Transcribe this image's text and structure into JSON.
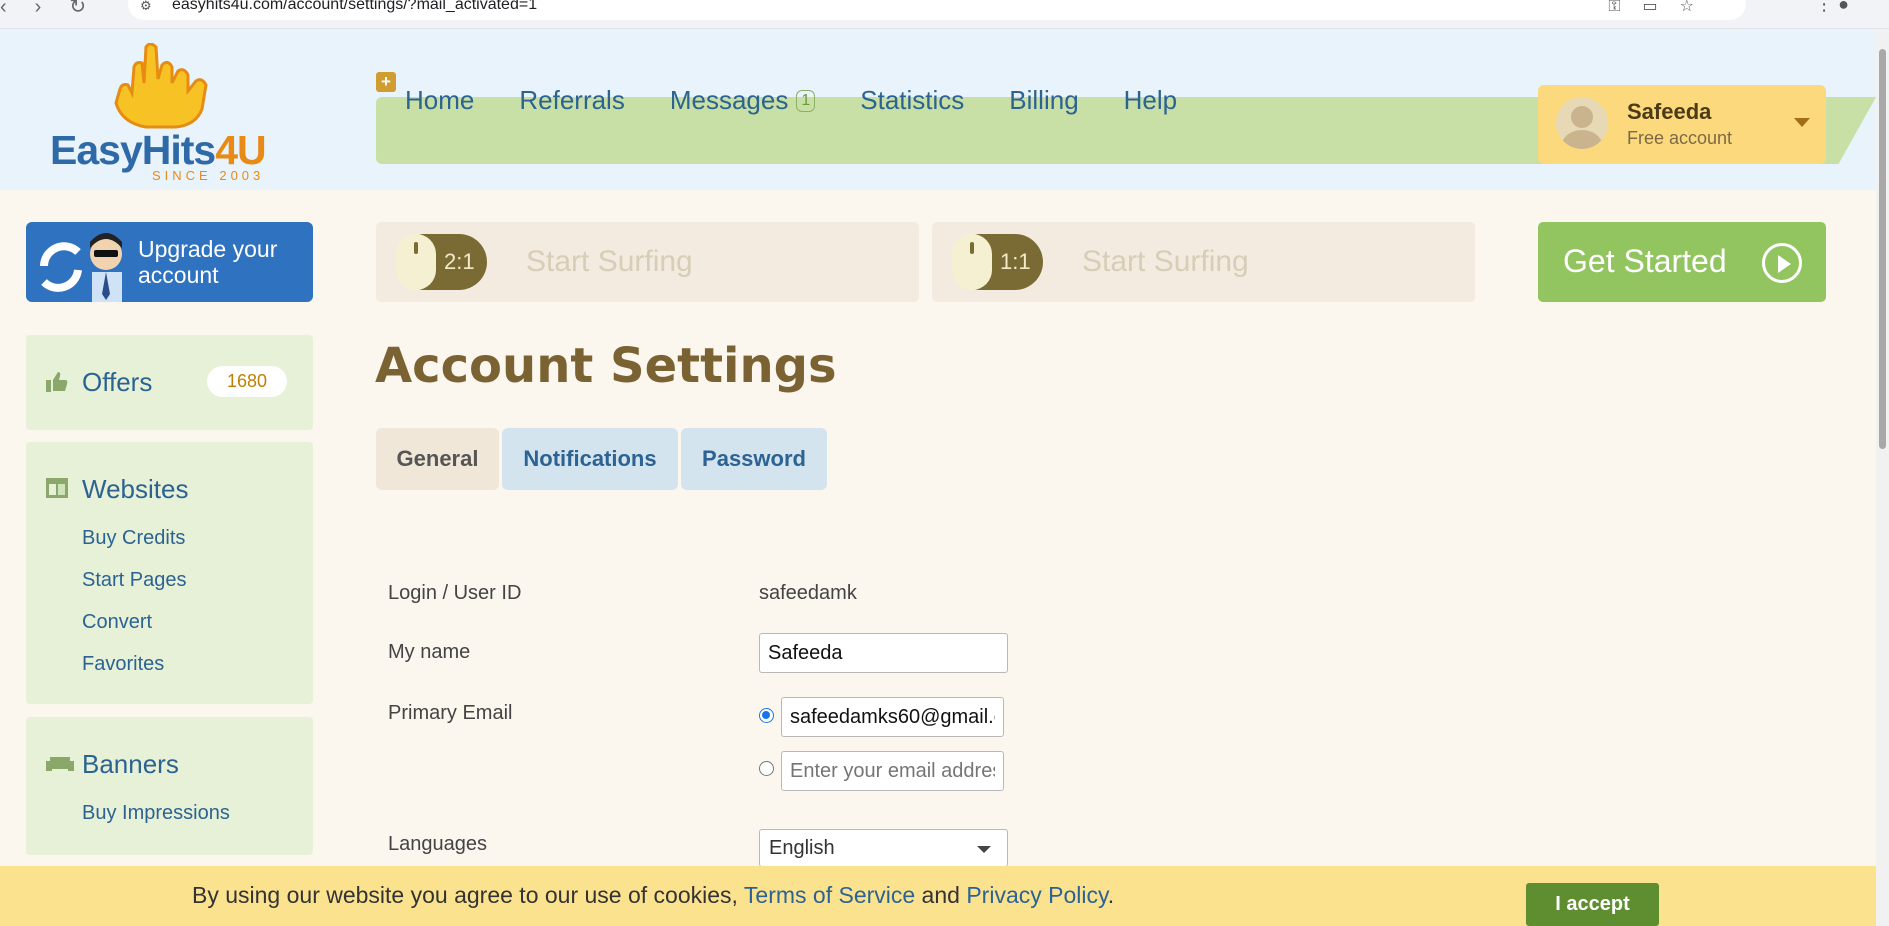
{
  "browser": {
    "url": "easyhits4u.com/account/settings/?mail_activated=1"
  },
  "header": {
    "logo_text_main": "EasyHits",
    "logo_text_accent": "4U",
    "logo_since": "SINCE 2003",
    "plus_symbol": "+",
    "nav": [
      {
        "label": "Home"
      },
      {
        "label": "Referrals"
      },
      {
        "label": "Messages",
        "badge": "1"
      },
      {
        "label": "Statistics"
      },
      {
        "label": "Billing"
      },
      {
        "label": "Help"
      }
    ],
    "account": {
      "name": "Safeeda",
      "type": "Free account"
    }
  },
  "sidebar": {
    "upgrade_label": "Upgrade your account",
    "offers": {
      "label": "Offers",
      "count": "1680"
    },
    "websites": {
      "label": "Websites",
      "items": [
        "Buy Credits",
        "Start Pages",
        "Convert",
        "Favorites"
      ]
    },
    "banners": {
      "label": "Banners",
      "items": [
        "Buy Impressions"
      ]
    }
  },
  "surf": [
    {
      "ratio": "2:1",
      "label": "Start Surfing"
    },
    {
      "ratio": "1:1",
      "label": "Start Surfing"
    }
  ],
  "get_started_label": "Get Started",
  "main": {
    "title": "Account Settings",
    "tabs": [
      "General",
      "Notifications",
      "Password"
    ],
    "form": {
      "login_label": "Login / User ID",
      "login_value": "safeedamk",
      "name_label": "My name",
      "name_value": "Safeeda",
      "email_label": "Primary Email",
      "email_value": "safeedamks60@gmail.c",
      "email_placeholder": "Enter your email addres",
      "languages_label": "Languages",
      "language_value": "English"
    }
  },
  "cookie": {
    "text_before": "By using our website you agree to our use of cookies, ",
    "tos_link": "Terms of Service",
    "and": " and ",
    "privacy_link": "Privacy Policy",
    "period": ".",
    "accept_label": "I accept"
  },
  "colors": {
    "brand_blue": "#2f6aa8",
    "brand_orange": "#e78a16",
    "nav_green": "#c8e0a5",
    "accept_green": "#5e8e30",
    "cookie_yellow": "#fbe28f"
  }
}
